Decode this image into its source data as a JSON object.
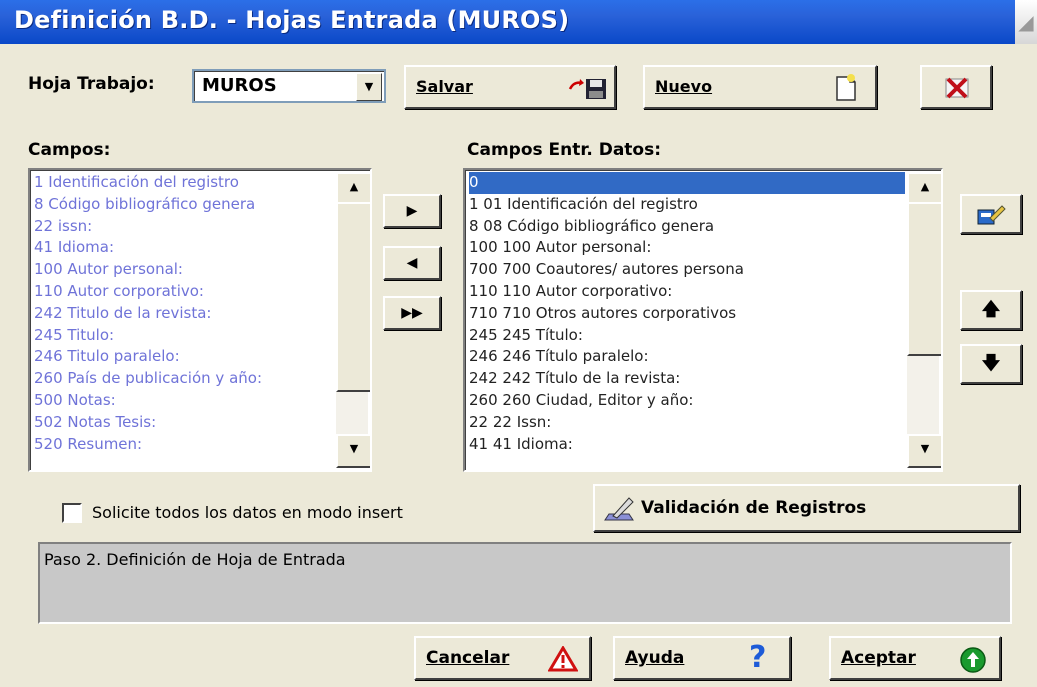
{
  "window": {
    "title": "Definición B.D. - Hojas Entrada (MUROS)"
  },
  "hoja_trabajo": {
    "label": "Hoja Trabajo:",
    "value": "MUROS"
  },
  "toolbar": {
    "salvar_label": "Salvar",
    "nuevo_label": "Nuevo"
  },
  "campos": {
    "label": "Campos:",
    "items": [
      "1 Identificación del registro",
      "8 Código bibliográfico genera",
      "22 issn:",
      "41 Idioma:",
      "100 Autor personal:",
      "110 Autor corporativo:",
      "242 Titulo de la revista:",
      "245 Titulo:",
      "246 Titulo paralelo:",
      "260 País de publicación y año:",
      "500 Notas:",
      "502 Notas Tesis:",
      "520 Resumen:"
    ]
  },
  "campos_entrada": {
    "label": "Campos Entr. Datos:",
    "items": [
      "0",
      "1 01 Identificación del registro",
      "8 08 Código bibliográfico genera",
      "100 100 Autor personal:",
      "700 700 Coautores/ autores persona",
      "110 110 Autor corporativo:",
      "710 710 Otros autores corporativos",
      "245 245 Título:",
      "246 246 Título paralelo:",
      "242 242 Título de la revista:",
      "260 260 Ciudad, Editor y año:",
      "22 22 Issn:",
      "41 41 Idioma:"
    ],
    "selected_index": 0
  },
  "options": {
    "insert_mode_label": "Solicite todos los datos en modo insert",
    "insert_mode_checked": false
  },
  "validacion": {
    "label": "Validación de Registros"
  },
  "status": {
    "text": "Paso 2. Definición de Hoja de Entrada"
  },
  "footer": {
    "cancelar_label": "Cancelar",
    "ayuda_label": "Ayuda",
    "aceptar_label": "Aceptar"
  },
  "icons": {
    "save": "save-disk-icon",
    "new": "new-document-icon",
    "delete": "delete-x-icon",
    "edit": "edit-field-icon",
    "move_right": "arrow-right-icon",
    "move_left": "arrow-left-icon",
    "move_all": "double-arrow-right-icon",
    "move_up": "arrow-up-icon",
    "move_down": "arrow-down-icon",
    "validate": "validate-pen-icon",
    "cancel": "warning-triangle-icon",
    "help": "question-mark-icon",
    "accept": "green-circle-up-icon"
  }
}
